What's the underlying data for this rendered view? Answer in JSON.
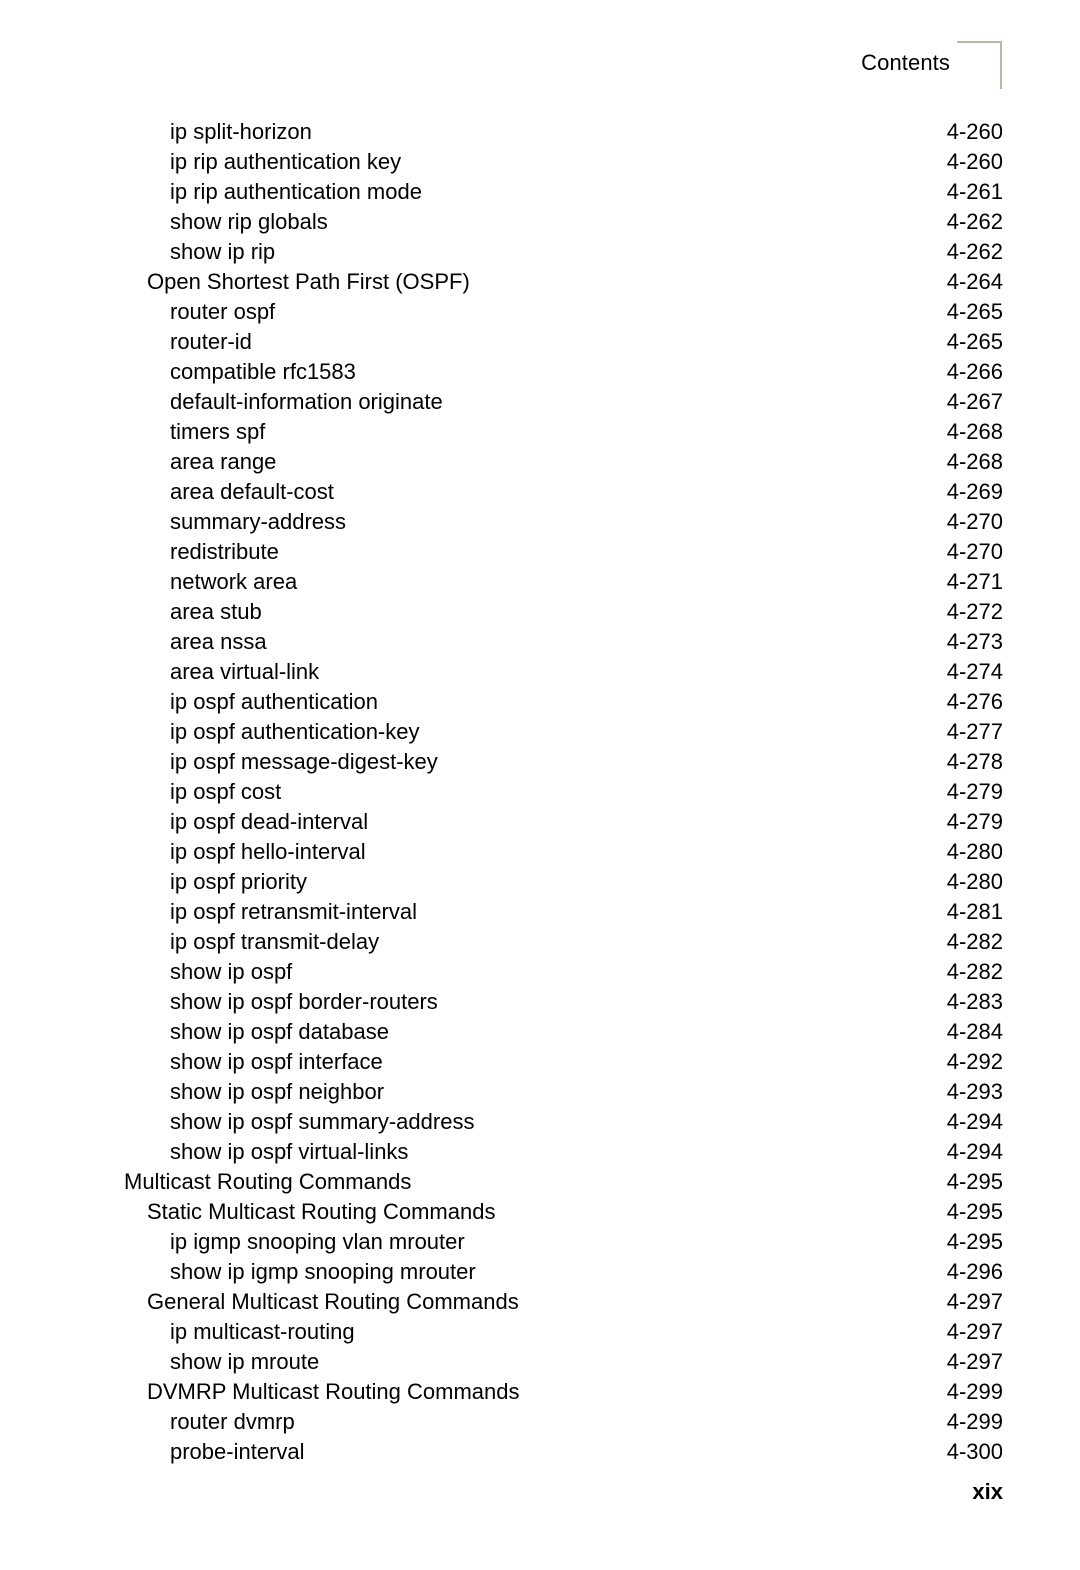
{
  "header": {
    "title": "Contents"
  },
  "footer": {
    "page_label": "xix"
  },
  "toc": {
    "entries": [
      {
        "label": "ip split-horizon",
        "page": "4-260",
        "level": 2
      },
      {
        "label": "ip rip authentication key",
        "page": "4-260",
        "level": 2
      },
      {
        "label": "ip rip authentication mode",
        "page": "4-261",
        "level": 2
      },
      {
        "label": "show rip globals",
        "page": "4-262",
        "level": 2
      },
      {
        "label": "show ip rip",
        "page": "4-262",
        "level": 2
      },
      {
        "label": "Open Shortest Path First (OSPF)",
        "page": "4-264",
        "level": 1
      },
      {
        "label": "router ospf",
        "page": "4-265",
        "level": 2
      },
      {
        "label": "router-id",
        "page": "4-265",
        "level": 2
      },
      {
        "label": "compatible rfc1583",
        "page": "4-266",
        "level": 2
      },
      {
        "label": "default-information originate",
        "page": "4-267",
        "level": 2
      },
      {
        "label": "timers spf",
        "page": "4-268",
        "level": 2
      },
      {
        "label": "area range",
        "page": "4-268",
        "level": 2
      },
      {
        "label": "area default-cost",
        "page": "4-269",
        "level": 2
      },
      {
        "label": "summary-address",
        "page": "4-270",
        "level": 2
      },
      {
        "label": "redistribute",
        "page": "4-270",
        "level": 2
      },
      {
        "label": "network area",
        "page": "4-271",
        "level": 2
      },
      {
        "label": "area stub",
        "page": "4-272",
        "level": 2
      },
      {
        "label": "area nssa",
        "page": "4-273",
        "level": 2
      },
      {
        "label": "area virtual-link",
        "page": "4-274",
        "level": 2
      },
      {
        "label": "ip ospf authentication",
        "page": "4-276",
        "level": 2
      },
      {
        "label": "ip ospf authentication-key",
        "page": "4-277",
        "level": 2
      },
      {
        "label": "ip ospf message-digest-key",
        "page": "4-278",
        "level": 2
      },
      {
        "label": "ip ospf cost",
        "page": "4-279",
        "level": 2
      },
      {
        "label": "ip ospf dead-interval",
        "page": "4-279",
        "level": 2
      },
      {
        "label": "ip ospf hello-interval",
        "page": "4-280",
        "level": 2
      },
      {
        "label": "ip ospf priority",
        "page": "4-280",
        "level": 2
      },
      {
        "label": "ip ospf retransmit-interval",
        "page": "4-281",
        "level": 2
      },
      {
        "label": "ip ospf transmit-delay",
        "page": "4-282",
        "level": 2
      },
      {
        "label": "show ip ospf",
        "page": "4-282",
        "level": 2
      },
      {
        "label": "show ip ospf border-routers",
        "page": "4-283",
        "level": 2
      },
      {
        "label": "show ip ospf database",
        "page": "4-284",
        "level": 2
      },
      {
        "label": "show ip ospf interface",
        "page": "4-292",
        "level": 2
      },
      {
        "label": "show ip ospf neighbor",
        "page": "4-293",
        "level": 2
      },
      {
        "label": "show ip ospf summary-address",
        "page": "4-294",
        "level": 2
      },
      {
        "label": "show ip ospf virtual-links",
        "page": "4-294",
        "level": 2
      },
      {
        "label": "Multicast Routing Commands",
        "page": "4-295",
        "level": 0
      },
      {
        "label": "Static Multicast Routing Commands",
        "page": "4-295",
        "level": 1
      },
      {
        "label": "ip igmp snooping vlan mrouter",
        "page": "4-295",
        "level": 2
      },
      {
        "label": "show ip igmp snooping mrouter",
        "page": "4-296",
        "level": 2
      },
      {
        "label": "General Multicast Routing Commands",
        "page": "4-297",
        "level": 1
      },
      {
        "label": "ip multicast-routing",
        "page": "4-297",
        "level": 2
      },
      {
        "label": "show ip mroute",
        "page": "4-297",
        "level": 2
      },
      {
        "label": "DVMRP Multicast Routing Commands",
        "page": "4-299",
        "level": 1
      },
      {
        "label": "router dvmrp",
        "page": "4-299",
        "level": 2
      },
      {
        "label": "probe-interval",
        "page": "4-300",
        "level": 2
      }
    ]
  }
}
